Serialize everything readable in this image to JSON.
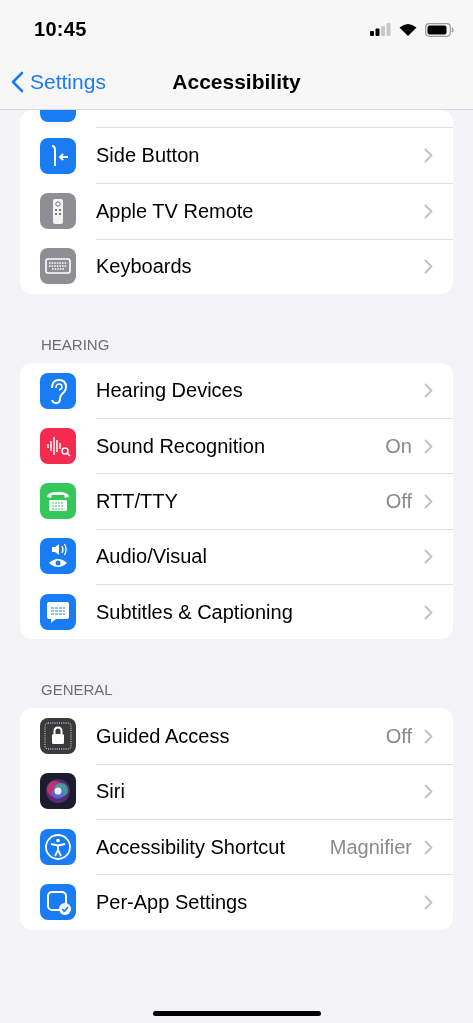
{
  "status_bar": {
    "time": "10:45"
  },
  "nav": {
    "back": "Settings",
    "title": "Accessibility"
  },
  "groups": [
    {
      "rows": [
        {
          "kind": "partial"
        },
        {
          "kind": "row",
          "label": "Side Button"
        },
        {
          "kind": "row",
          "label": "Apple TV Remote"
        },
        {
          "kind": "row",
          "label": "Keyboards"
        }
      ]
    },
    {
      "header": "HEARING",
      "rows": [
        {
          "kind": "row",
          "label": "Hearing Devices"
        },
        {
          "kind": "row",
          "label": "Sound Recognition",
          "value": "On"
        },
        {
          "kind": "row",
          "label": "RTT/TTY",
          "value": "Off"
        },
        {
          "kind": "row",
          "label": "Audio/Visual"
        },
        {
          "kind": "row",
          "label": "Subtitles & Captioning"
        }
      ]
    },
    {
      "header": "GENERAL",
      "rows": [
        {
          "kind": "row",
          "label": "Guided Access",
          "value": "Off"
        },
        {
          "kind": "row",
          "label": "Siri"
        },
        {
          "kind": "row",
          "label": "Accessibility Shortcut",
          "value": "Magnifier"
        },
        {
          "kind": "row",
          "label": "Per-App Settings"
        }
      ]
    }
  ]
}
